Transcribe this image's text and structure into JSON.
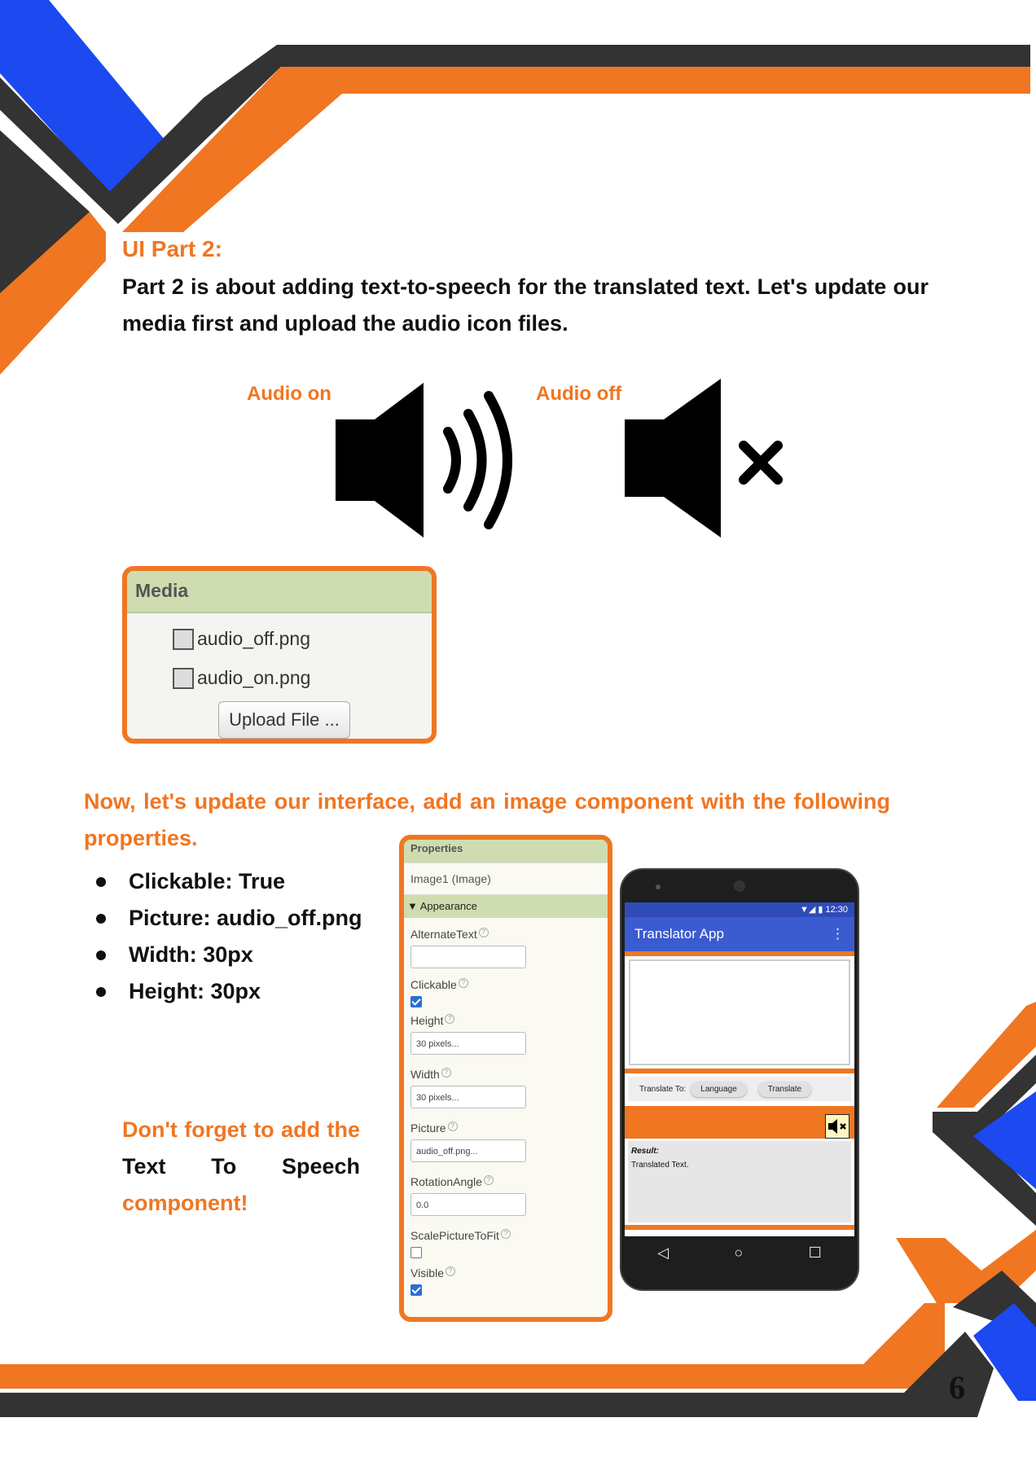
{
  "heading": "UI Part 2:",
  "intro": "Part 2 is about adding text-to-speech for the translated text. Let's update our media first and upload the audio icon files.",
  "audio_labels": {
    "on": "Audio on",
    "off": "Audio off"
  },
  "media_panel": {
    "title": "Media",
    "files": [
      "audio_off.png",
      "audio_on.png"
    ],
    "upload_label": "Upload File ..."
  },
  "instructions": "Now, let's update our interface, add an image component with the following properties.",
  "properties_list": [
    "Clickable: True",
    "Picture: audio_off.png",
    "Width: 30px",
    "Height: 30px"
  ],
  "reminder": {
    "part1": "Don't forget to add the ",
    "part2": "Text To Speech",
    "part3": " component!"
  },
  "properties_panel": {
    "title": "Properties",
    "component": "Image1 (Image)",
    "section": "Appearance",
    "fields": {
      "alternate_text_label": "AlternateText",
      "alternate_text_value": "",
      "clickable_label": "Clickable",
      "clickable_checked": true,
      "height_label": "Height",
      "height_value": "30 pixels...",
      "width_label": "Width",
      "width_value": "30 pixels...",
      "picture_label": "Picture",
      "picture_value": "audio_off.png...",
      "rotation_label": "RotationAngle",
      "rotation_value": "0.0",
      "scale_label": "ScalePictureToFit",
      "scale_checked": false,
      "visible_label": "Visible",
      "visible_checked": true
    }
  },
  "phone": {
    "time": "12:30",
    "app_title": "Translator App",
    "translate_to_label": "Translate To:",
    "language_button": "Language",
    "translate_button": "Translate",
    "result_label": "Result:",
    "result_text": "Translated Text."
  },
  "page_number": "6",
  "colors": {
    "orange": "#f07622",
    "blue": "#1c49f0",
    "dark": "#333333",
    "app_blue": "#3b5bd0"
  }
}
